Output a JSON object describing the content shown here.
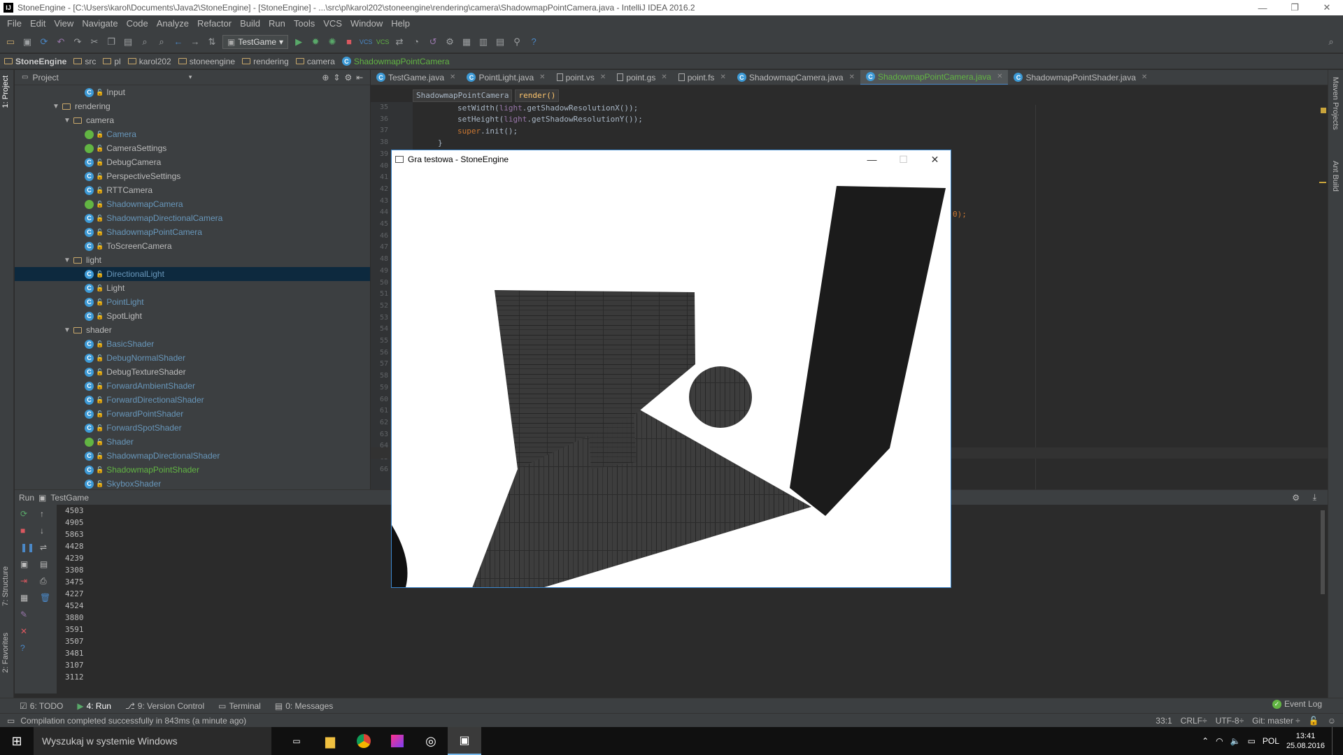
{
  "window": {
    "title": "StoneEngine - [C:\\Users\\karol\\Documents\\Java2\\StoneEngine] - [StoneEngine] - ...\\src\\pl\\karol202\\stoneengine\\rendering\\camera\\ShadowmapPointCamera.java - IntelliJ IDEA 2016.2",
    "app_icon": "IJ"
  },
  "menu": [
    "File",
    "Edit",
    "View",
    "Navigate",
    "Code",
    "Analyze",
    "Refactor",
    "Build",
    "Run",
    "Tools",
    "VCS",
    "Window",
    "Help"
  ],
  "toolbar": {
    "run_config": "TestGame"
  },
  "breadcrumbs": [
    "StoneEngine",
    "src",
    "pl",
    "karol202",
    "stoneengine",
    "rendering",
    "camera",
    "ShadowmapPointCamera"
  ],
  "project_panel": {
    "title": "Project",
    "side_tab": "1: Project"
  },
  "tree": [
    {
      "label": "Input",
      "kind": "class",
      "depth": 6,
      "color": "normal"
    },
    {
      "label": "rendering",
      "kind": "folder",
      "depth": 4,
      "color": "normal",
      "open": true
    },
    {
      "label": "camera",
      "kind": "folder",
      "depth": 5,
      "color": "normal",
      "open": true
    },
    {
      "label": "Camera",
      "kind": "class-a",
      "depth": 6,
      "color": "blue"
    },
    {
      "label": "CameraSettings",
      "kind": "iface",
      "depth": 6,
      "color": "normal"
    },
    {
      "label": "DebugCamera",
      "kind": "class",
      "depth": 6,
      "color": "normal"
    },
    {
      "label": "PerspectiveSettings",
      "kind": "class",
      "depth": 6,
      "color": "normal"
    },
    {
      "label": "RTTCamera",
      "kind": "class",
      "depth": 6,
      "color": "normal"
    },
    {
      "label": "ShadowmapCamera",
      "kind": "class-a",
      "depth": 6,
      "color": "blue"
    },
    {
      "label": "ShadowmapDirectionalCamera",
      "kind": "class",
      "depth": 6,
      "color": "blue"
    },
    {
      "label": "ShadowmapPointCamera",
      "kind": "class",
      "depth": 6,
      "color": "blue"
    },
    {
      "label": "ToScreenCamera",
      "kind": "class",
      "depth": 6,
      "color": "normal"
    },
    {
      "label": "light",
      "kind": "folder",
      "depth": 5,
      "color": "normal",
      "open": true
    },
    {
      "label": "DirectionalLight",
      "kind": "class",
      "depth": 6,
      "color": "blue",
      "selected": true
    },
    {
      "label": "Light",
      "kind": "class",
      "depth": 6,
      "color": "normal"
    },
    {
      "label": "PointLight",
      "kind": "class",
      "depth": 6,
      "color": "blue"
    },
    {
      "label": "SpotLight",
      "kind": "class",
      "depth": 6,
      "color": "normal"
    },
    {
      "label": "shader",
      "kind": "folder",
      "depth": 5,
      "color": "normal",
      "open": true
    },
    {
      "label": "BasicShader",
      "kind": "class",
      "depth": 6,
      "color": "blue"
    },
    {
      "label": "DebugNormalShader",
      "kind": "class",
      "depth": 6,
      "color": "blue"
    },
    {
      "label": "DebugTextureShader",
      "kind": "class",
      "depth": 6,
      "color": "normal"
    },
    {
      "label": "ForwardAmbientShader",
      "kind": "class",
      "depth": 6,
      "color": "blue"
    },
    {
      "label": "ForwardDirectionalShader",
      "kind": "class",
      "depth": 6,
      "color": "blue"
    },
    {
      "label": "ForwardPointShader",
      "kind": "class",
      "depth": 6,
      "color": "blue"
    },
    {
      "label": "ForwardSpotShader",
      "kind": "class",
      "depth": 6,
      "color": "blue"
    },
    {
      "label": "Shader",
      "kind": "class-a",
      "depth": 6,
      "color": "blue"
    },
    {
      "label": "ShadowmapDirectionalShader",
      "kind": "class",
      "depth": 6,
      "color": "blue"
    },
    {
      "label": "ShadowmapPointShader",
      "kind": "class",
      "depth": 6,
      "color": "green"
    },
    {
      "label": "SkyboxShader",
      "kind": "class",
      "depth": 6,
      "color": "blue"
    }
  ],
  "editor_tabs": [
    {
      "label": "TestGame.java",
      "icon": "class",
      "active": false
    },
    {
      "label": "PointLight.java",
      "icon": "class",
      "active": false
    },
    {
      "label": "point.vs",
      "icon": "file",
      "active": false
    },
    {
      "label": "point.gs",
      "icon": "file",
      "active": false
    },
    {
      "label": "point.fs",
      "icon": "file",
      "active": false
    },
    {
      "label": "ShadowmapCamera.java",
      "icon": "class",
      "active": false
    },
    {
      "label": "ShadowmapPointCamera.java",
      "icon": "class",
      "active": true
    },
    {
      "label": "ShadowmapPointShader.java",
      "icon": "class",
      "active": false
    }
  ],
  "editor_crumbs": {
    "class": "ShadowmapPointCamera",
    "method": "render()"
  },
  "line_numbers": [
    "35",
    "36",
    "37",
    "38",
    "39",
    "40",
    "41",
    "42",
    "43",
    "44",
    "45",
    "46",
    "47",
    "48",
    "49",
    "50",
    "51",
    "52",
    "53",
    "54",
    "55",
    "56",
    "57",
    "58",
    "59",
    "60",
    "61",
    "62",
    "63",
    "64",
    "65",
    "66"
  ],
  "code": {
    "line35_method": "setWidth(",
    "line35_arg": "light",
    "line35_rest": ".getShadowResolutionX());",
    "line36_method": "setHeight(",
    "line36_arg": "light",
    "line36_rest": ".getShadowResolutionY());",
    "line37_kw": "super",
    "line37_rest": ".init();",
    "line38": "}",
    "line44_tail": "0);"
  },
  "run_panel": {
    "label": "Run",
    "config": "TestGame"
  },
  "console_lines": [
    "4503",
    "4905",
    "5863",
    "4428",
    "4239",
    "3308",
    "3475",
    "4227",
    "4524",
    "3880",
    "3591",
    "3507",
    "3481",
    "3107",
    "3112"
  ],
  "game_window": {
    "title": "Gra testowa - StoneEngine"
  },
  "bottom_tabs": [
    {
      "label": "6: TODO",
      "active": false
    },
    {
      "label": "4: Run",
      "active": true
    },
    {
      "label": "9: Version Control",
      "active": false
    },
    {
      "label": "Terminal",
      "active": false
    },
    {
      "label": "0: Messages",
      "active": false
    }
  ],
  "event_log": "Event Log",
  "status": {
    "message": "Compilation completed successfully in 843ms (a minute ago)",
    "position": "33:1",
    "line_sep": "CRLF÷",
    "encoding": "UTF-8÷",
    "git": "Git: master ÷"
  },
  "side_tabs": {
    "structure": "7: Structure",
    "favorites": "2: Favorites",
    "maven": "Maven Projects",
    "ant": "Ant Build"
  },
  "taskbar": {
    "search_placeholder": "Wyszukaj w systemie Windows",
    "lang": "POL",
    "time": "13:41",
    "date": "25.08.2016"
  }
}
